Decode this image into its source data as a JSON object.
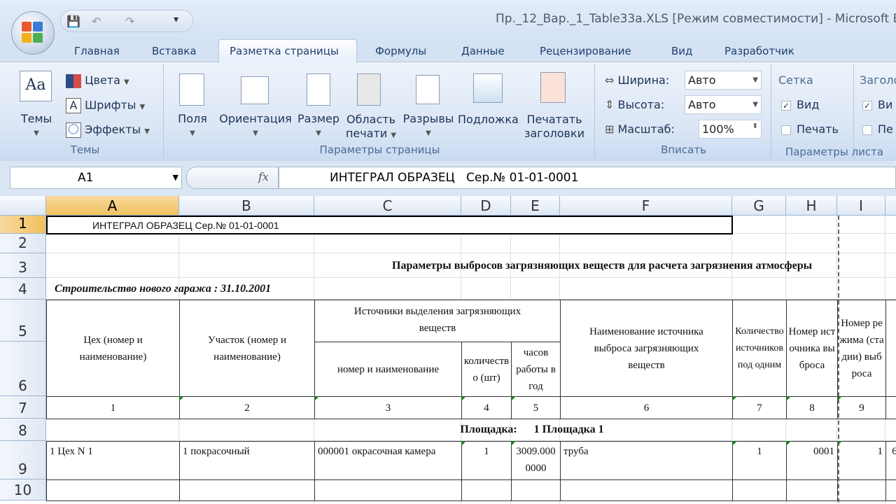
{
  "window": {
    "title": "Пр._12_Вар._1_Table33a.XLS  [Режим совместимости] - Microsoft E"
  },
  "qat": {
    "save": "💾",
    "undo": "↶",
    "redo": "↷",
    "customize": "▾"
  },
  "tabs": [
    "Главная",
    "Вставка",
    "Разметка страницы",
    "Формулы",
    "Данные",
    "Рецензирование",
    "Вид",
    "Разработчик"
  ],
  "active_tab": "Разметка страницы",
  "ribbon": {
    "themes": {
      "label": "Темы",
      "themes_btn": "Темы",
      "colors": "Цвета",
      "fonts": "Шрифты",
      "effects": "Эффекты",
      "aa": "Aa"
    },
    "page_setup": {
      "label": "Параметры страницы",
      "margins": "Поля",
      "orientation": "Ориентация",
      "size": "Размер",
      "print_area_1": "Область",
      "print_area_2": "печати",
      "breaks": "Разрывы",
      "background": "Подложка",
      "print_titles_1": "Печатать",
      "print_titles_2": "заголовки"
    },
    "fit": {
      "label": "Вписать",
      "width_label": "Ширина:",
      "width_value": "Авто",
      "height_label": "Высота:",
      "height_value": "Авто",
      "scale_label": "Масштаб:",
      "scale_value": "100%"
    },
    "sheet_options": {
      "label": "Параметры листа",
      "gridlines": "Сетка",
      "grid_view": "Вид",
      "grid_print": "Печать",
      "headings": "Заголо",
      "head_view": "Ви",
      "head_print": "Пе",
      "grid_view_checked": true,
      "grid_print_checked": false
    }
  },
  "formula_bar": {
    "name_box": "A1",
    "fx": "fx",
    "value": "ИНТЕГРАЛ ОБРАЗЕЦ   Сер.№ 01-01-0001"
  },
  "columns": [
    "A",
    "B",
    "C",
    "D",
    "E",
    "F",
    "G",
    "H",
    "I"
  ],
  "rows": [
    "1",
    "2",
    "3",
    "4",
    "5",
    "6",
    "7",
    "8",
    "9",
    "10"
  ],
  "cells": {
    "a1": "ИНТЕГРАЛ ОБРАЗЕЦ   Сер.№ 01-01-0001",
    "title": "Параметры выбросов загрязняющих веществ для расчета загрязнения атмосферы",
    "subtitle": "Строительство нового гаража  : 31.10.2001",
    "h_a": "Цех (номер и наименование)",
    "h_b": "Участок (номер и наименование)",
    "h_cde": "Источники выделения загрязняющих веществ",
    "h_c": "номер и наименование",
    "h_d": "количество (шт)",
    "h_e": "часов работы в год",
    "h_f": "Наименование источника выброса загрязняющих веществ",
    "h_g": "Количество источников под одним",
    "h_h": "Номер источника выброса",
    "h_i": "Номер режима (стадии) выброса",
    "n": [
      "1",
      "2",
      "3",
      "4",
      "5",
      "6",
      "7",
      "8",
      "9"
    ],
    "site": "Площадка:      1 Площадка 1",
    "r9": {
      "a": "1 Цех N 1",
      "b": "1  покрасочный",
      "c": "000001 окрасочная камера",
      "d": "1",
      "e": "3009.0000000",
      "f": "труба",
      "g": "1",
      "h": "0001",
      "i": "1",
      "j": "6"
    }
  }
}
